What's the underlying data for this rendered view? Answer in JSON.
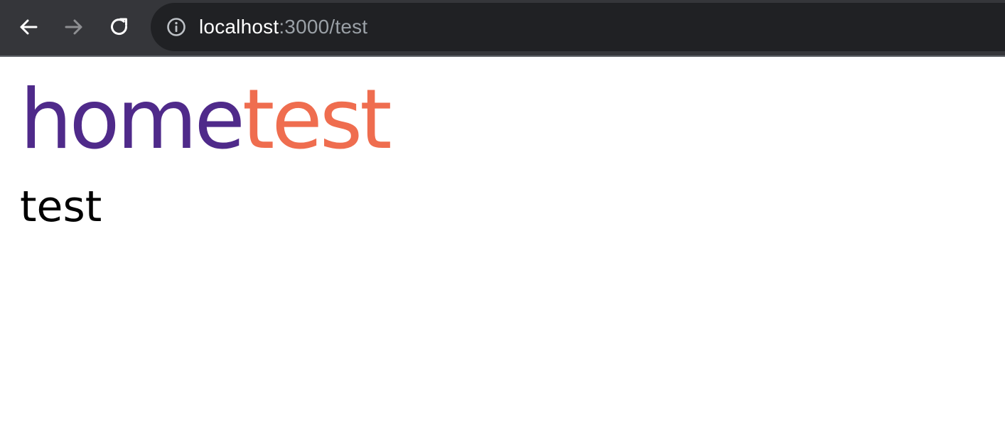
{
  "browser": {
    "url_host": "localhost",
    "url_rest": ":3000/test",
    "icons": {
      "back": "arrow-left-icon",
      "forward": "arrow-right-icon",
      "reload": "reload-icon",
      "info": "info-circle-icon"
    },
    "colors": {
      "toolbar": "#35363a",
      "omnibox": "#202124",
      "url_host": "#ffffff",
      "url_rest": "#9aa0a6"
    }
  },
  "page": {
    "heading_part_1": "home",
    "heading_part_2": "test",
    "body_text": "test",
    "colors": {
      "heading_part_1": "#4f2a8a",
      "heading_part_2": "#ef6d4f",
      "body_text": "#000000"
    }
  }
}
